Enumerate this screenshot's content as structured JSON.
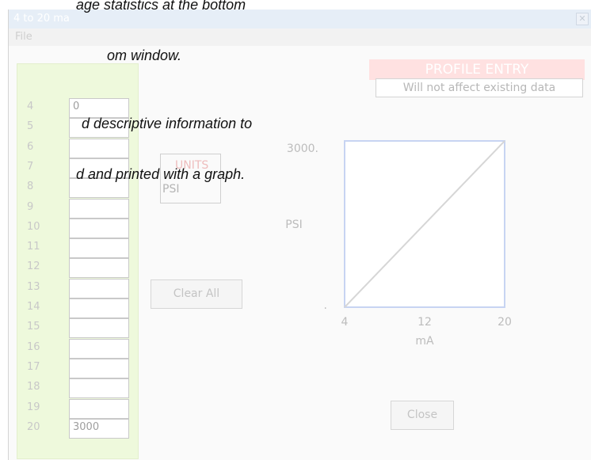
{
  "document": {
    "lines": [
      "age statistics at the bottom",
      "om window.",
      "d descriptive information to",
      "d and printed with a graph."
    ]
  },
  "window": {
    "title": "4 to 20 ma",
    "close_icon": "close-icon",
    "menu": [
      "File"
    ]
  },
  "profile": {
    "title": "PROFILE ENTRY",
    "subtitle": "Will not affect existing data"
  },
  "table": {
    "rows": [
      {
        "label": "4",
        "value": "0"
      },
      {
        "label": "5",
        "value": ""
      },
      {
        "label": "6",
        "value": ""
      },
      {
        "label": "7",
        "value": ""
      },
      {
        "label": "8",
        "value": ""
      },
      {
        "label": "9",
        "value": ""
      },
      {
        "label": "10",
        "value": ""
      },
      {
        "label": "11",
        "value": ""
      },
      {
        "label": "12",
        "value": ""
      },
      {
        "label": "13",
        "value": ""
      },
      {
        "label": "14",
        "value": ""
      },
      {
        "label": "15",
        "value": ""
      },
      {
        "label": "16",
        "value": ""
      },
      {
        "label": "17",
        "value": ""
      },
      {
        "label": "18",
        "value": ""
      },
      {
        "label": "19",
        "value": ""
      },
      {
        "label": "20",
        "value": "3000"
      }
    ]
  },
  "units": {
    "title": "UNITS",
    "value": "PSI"
  },
  "buttons": {
    "clear_all": "Clear All",
    "close": "Close"
  },
  "chart_data": {
    "type": "line",
    "x": [
      4,
      20
    ],
    "y": [
      0,
      3000
    ],
    "xlabel": "mA",
    "ylabel": "PSI",
    "xticks": [
      "4",
      "12",
      "20"
    ],
    "yticks": [
      "3000.",
      "."
    ],
    "xlim": [
      4,
      20
    ],
    "ylim": [
      0,
      3000
    ],
    "grid": false,
    "line_color": "#d6d6d6",
    "frame_color": "#c7d4f2"
  },
  "colors": {
    "panel": "#eef9dc",
    "profile_bg": "#ffe1e1",
    "units_title": "#eebcbc"
  }
}
